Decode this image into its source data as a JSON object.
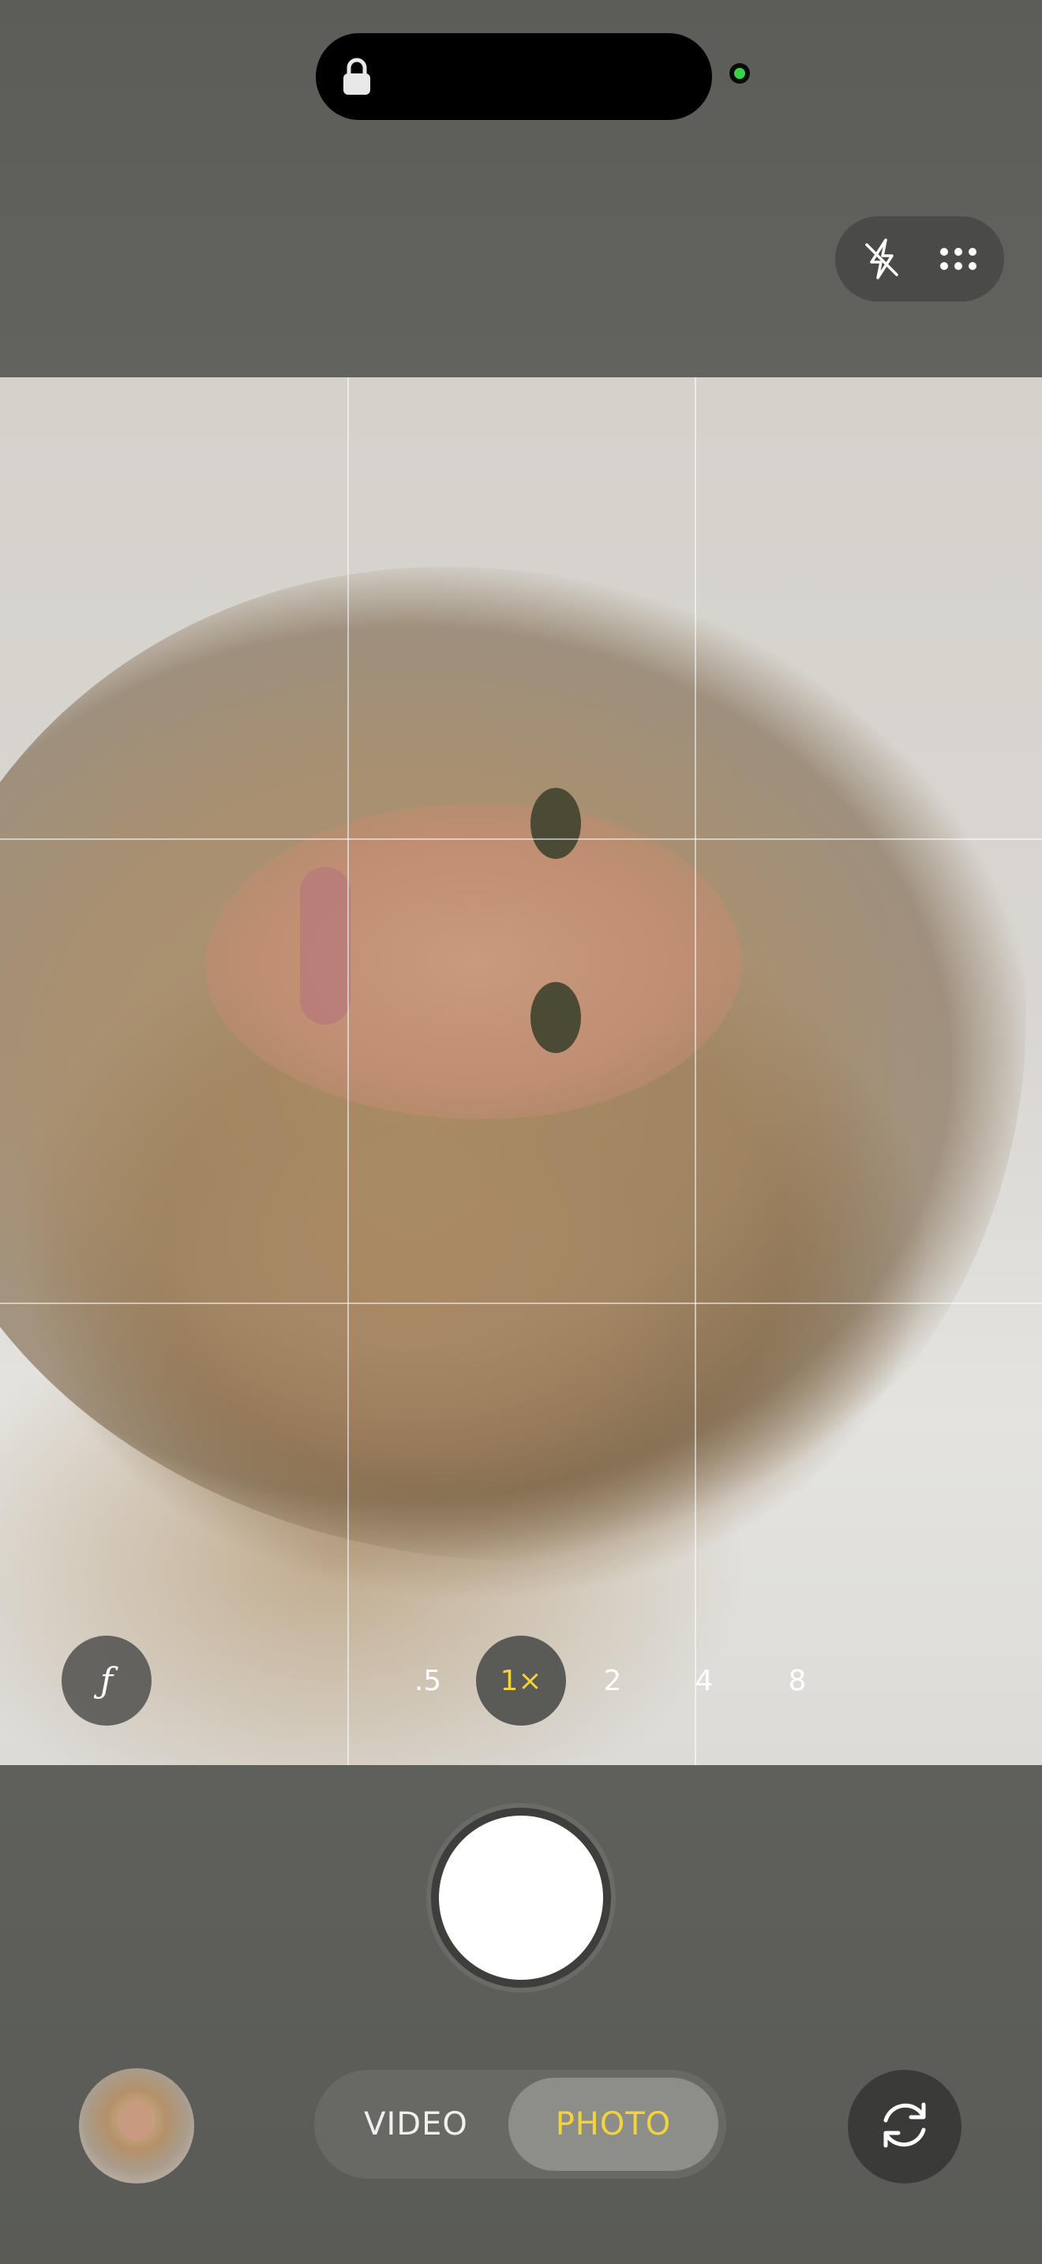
{
  "status": {
    "icons": [
      "lock-icon",
      "camera-active-indicator"
    ],
    "indicator_color": "#3ad04a"
  },
  "top_controls": {
    "flash_icon": "flash-off-icon",
    "more_icon": "more-grid-icon"
  },
  "viewfinder": {
    "grid": "3x3"
  },
  "aperture_button": {
    "label": "ƒ"
  },
  "zoom_levels": [
    {
      "label": ".5",
      "active": false
    },
    {
      "label": "1×",
      "active": true
    },
    {
      "label": "2",
      "active": false
    },
    {
      "label": "4",
      "active": false
    },
    {
      "label": "8",
      "active": false
    }
  ],
  "modes": {
    "video": "VIDEO",
    "photo": "PHOTO",
    "selected": "PHOTO"
  },
  "accent_color": "#f2d43a",
  "bottom_controls": {
    "gallery_icon": "gallery-thumbnail",
    "switch_icon": "switch-camera-icon"
  }
}
